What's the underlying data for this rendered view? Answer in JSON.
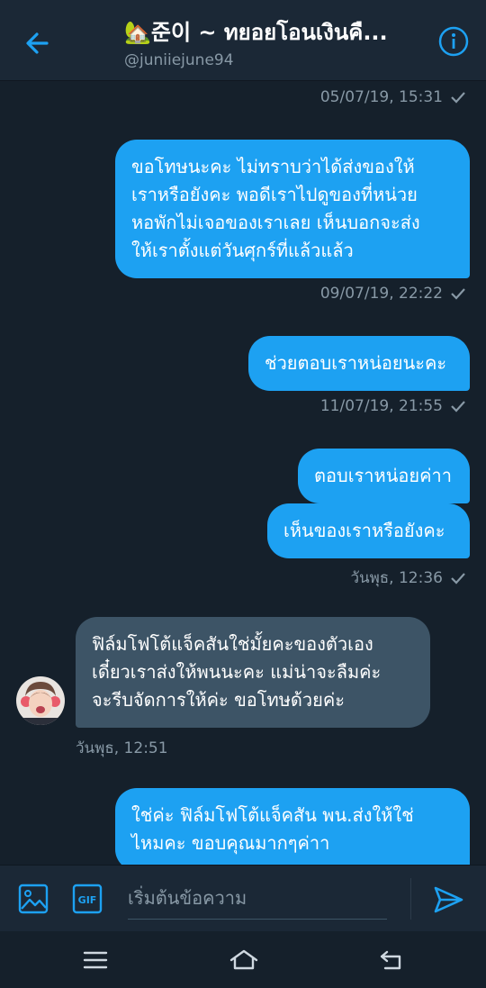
{
  "header": {
    "title": "🏡준이 ~ ทยอยโอนเงินคื...",
    "handle": "@juniiejune94"
  },
  "messages": [
    {
      "meta": "05/07/19, 15:31"
    },
    {
      "text_lines": [
        "ขอโทษนะคะ ไม่ทราบว่าได้ส่งของให้",
        "เราหรือยังคะ พอดีเราไปดูของที่หน่วย",
        "หอพักไม่เจอของเราเลย เห็นบอกจะส่ง",
        "ให้เราตั้งแต่วันศุกร์ที่แล้วแล้ว"
      ],
      "meta": "09/07/19, 22:22"
    },
    {
      "text": "ช่วยตอบเราหน่อยนะคะ",
      "meta": "11/07/19, 21:55"
    },
    {
      "text": "ตอบเราหน่อยค่าา"
    },
    {
      "text": "เห็นของเราหรือยังคะ",
      "meta": "วันพุธ, 12:36"
    },
    {
      "text_lines": [
        "ฟิล์มโฟโต้แจ็คสันใช่มั้ยคะของตัวเอง",
        "เดี๋ยวเราส่งให้พนนะคะ แม่น่าจะลืมค่ะ",
        "จะรีบจัดการให้ค่ะ ขอโทษด้วยค่ะ"
      ],
      "meta": "วันพุธ, 12:51"
    },
    {
      "text_lines": [
        "ใช่ค่ะ ฟิล์มโฟโต้แจ็คสัน พน.ส่งให้ใช่",
        "ไหมคะ ขอบคุณมากๆค่าา"
      ]
    }
  ],
  "composer": {
    "placeholder": "เริ่มต้นข้อความ",
    "gif_label": "GIF"
  },
  "colors": {
    "background": "#15202b",
    "header": "#1b2836",
    "accent": "#1da1f2",
    "received_bubble": "#3d5466",
    "muted_text": "#8899a6"
  },
  "icons": {
    "back": "arrow-left-icon",
    "info": "info-icon",
    "media": "image-icon",
    "gif": "gif-icon",
    "send": "send-icon",
    "nav_recent": "menu-icon",
    "nav_home": "home-icon",
    "nav_back": "back-icon"
  }
}
